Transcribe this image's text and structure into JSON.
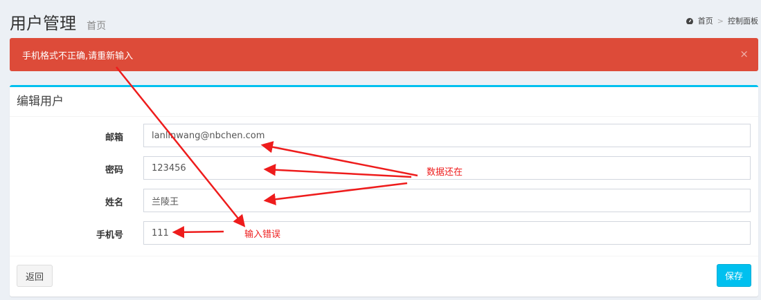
{
  "header": {
    "title": "用户管理",
    "subtitle": "首页",
    "breadcrumb": [
      "首页",
      "控制面板"
    ],
    "home_icon": "dashboard-icon"
  },
  "alert": {
    "message": "手机格式不正确,请重新输入",
    "close": "×",
    "color": "#dd4b39"
  },
  "form": {
    "title": "编辑用户",
    "fields": [
      {
        "label": "邮箱",
        "value": "lanlinwang@nbchen.com"
      },
      {
        "label": "密码",
        "value": "123456"
      },
      {
        "label": "姓名",
        "value": "兰陵王"
      },
      {
        "label": "手机号",
        "value": "111"
      }
    ],
    "back_label": "返回",
    "save_label": "保存",
    "accent": "#00c0ef"
  },
  "annotations": {
    "data_kept": "数据还在",
    "input_error": "输入错误",
    "color": "#ee1c1c"
  }
}
